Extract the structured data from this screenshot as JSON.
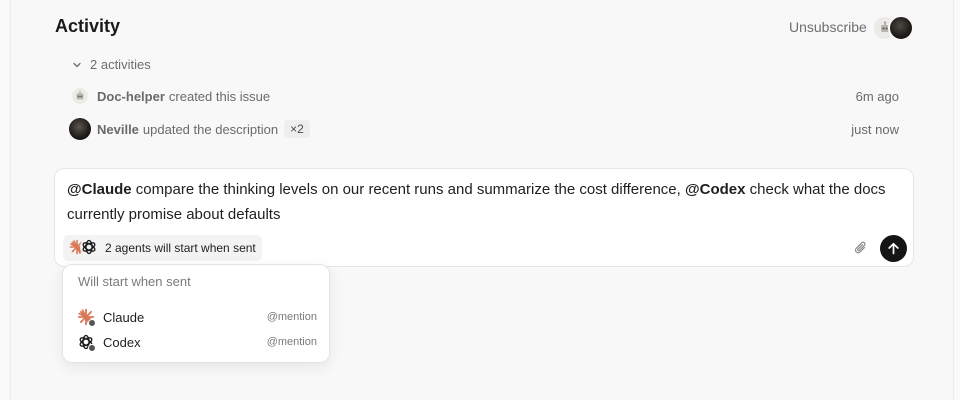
{
  "header": {
    "title": "Activity",
    "unsubscribe_label": "Unsubscribe"
  },
  "activity": {
    "toggle_label": "2 activities",
    "items": [
      {
        "actor": "Doc-helper",
        "action": "created this issue",
        "badge": "",
        "time": "6m ago",
        "avatar": "robot-avatar"
      },
      {
        "actor": "Neville",
        "action": "updated the description",
        "badge": "×2",
        "time": "just now",
        "avatar": "user-avatar"
      }
    ]
  },
  "composer": {
    "segments": [
      {
        "type": "mention",
        "text": "@Claude"
      },
      {
        "type": "text",
        "text": " compare the thinking levels on our recent runs and summarize the cost difference, "
      },
      {
        "type": "mention",
        "text": "@Codex"
      },
      {
        "type": "text",
        "text": " check what the docs currently promise about defaults"
      }
    ],
    "agents_chip_label": "2 agents will start when sent",
    "icons": {
      "attach": "paperclip-icon",
      "send": "arrow-up-icon"
    }
  },
  "popover": {
    "title": "Will start when sent",
    "items": [
      {
        "name": "Claude",
        "tag": "@mention",
        "icon": "claude-icon"
      },
      {
        "name": "Codex",
        "tag": "@mention",
        "icon": "codex-icon"
      }
    ]
  },
  "colors": {
    "claude": "#d97757",
    "send_button": "#151515",
    "background": "#f8f8f8"
  }
}
